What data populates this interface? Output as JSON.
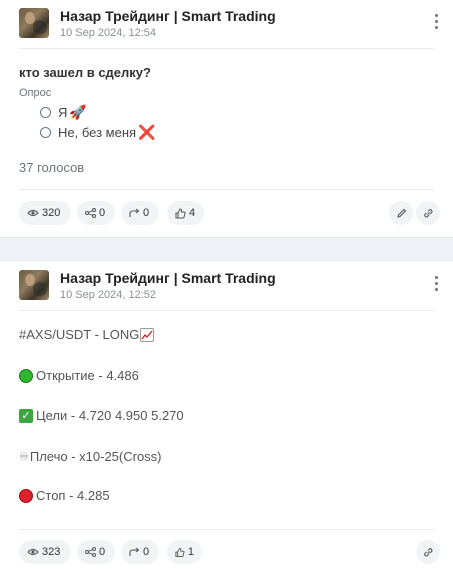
{
  "posts": [
    {
      "channel": "Назар Трейдинг | Smart Trading",
      "date": "10 Sep 2024, 12:54",
      "poll": {
        "question": "кто зашел в сделку?",
        "type": "Опрос",
        "options": [
          {
            "label": "Я",
            "emoji": "🚀"
          },
          {
            "label": "Не, без меня",
            "emoji": "❌"
          }
        ],
        "votes": "37 голосов"
      },
      "stats": {
        "views": "320",
        "shares": "0",
        "forwards": "0",
        "likes": "4"
      }
    },
    {
      "channel": "Назар Трейдинг | Smart Trading",
      "date": "10 Sep 2024, 12:52",
      "lines": {
        "pair": "#AXS/USDT - LONG",
        "open": "Открытие - 4.486",
        "targets": "Цели - 4.720 4.950 5.270",
        "leverage": "Плечо - x10-25(Cross)",
        "leverage_icon": "♾",
        "stop": " Стоп - 4.285"
      },
      "stats": {
        "views": "323",
        "shares": "0",
        "forwards": "0",
        "likes": "1"
      }
    }
  ],
  "colors": {
    "button_bg": "#f1f3f5",
    "divider": "#e9ecef",
    "section_gap": "#eef1f5"
  }
}
